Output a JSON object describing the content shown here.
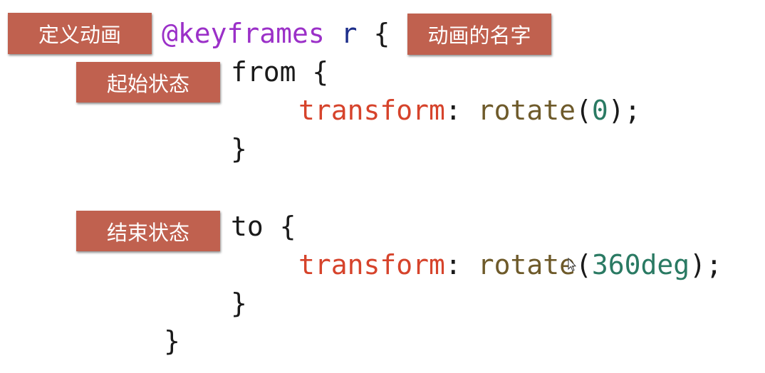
{
  "labels": {
    "define_animation": "定义动画",
    "animation_name": "动画的名字",
    "start_state": "起始状态",
    "end_state": "结束状态"
  },
  "code": {
    "at_rule": "@keyframes",
    "name": "r",
    "open_brace": "{",
    "from": "from",
    "to": "to",
    "property": "transform",
    "colon": ":",
    "function": "rotate",
    "from_value": "0",
    "to_value": "360deg",
    "close_brace": "}"
  }
}
